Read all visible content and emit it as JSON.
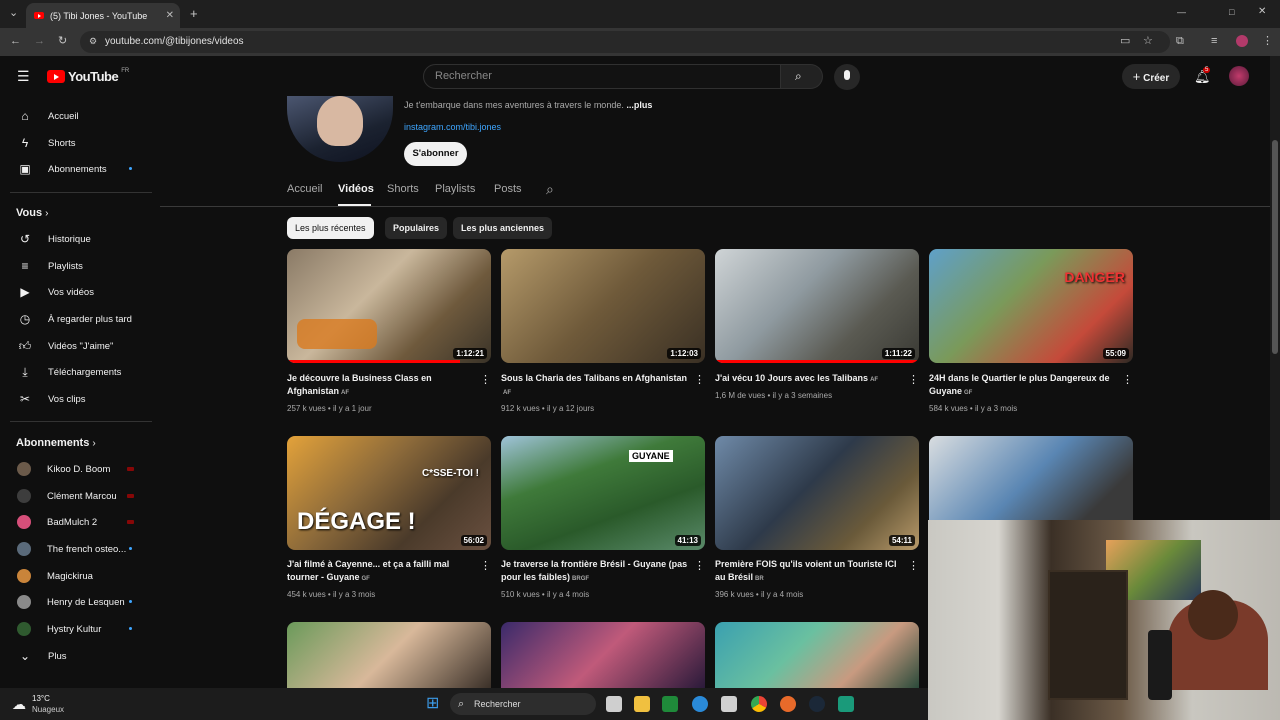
{
  "browser": {
    "tab_title": "(5) Tibi Jones - YouTube",
    "url": "youtube.com/@tibijones/videos"
  },
  "header": {
    "logo_text": "YouTube",
    "region": "FR",
    "search_placeholder": "Rechercher",
    "create_label": "Créer",
    "notif_count": "5"
  },
  "sidebar": {
    "main": [
      {
        "label": "Accueil",
        "icon": "home-icon"
      },
      {
        "label": "Shorts",
        "icon": "shorts-icon"
      },
      {
        "label": "Abonnements",
        "icon": "subscriptions-icon"
      }
    ],
    "you_title": "Vous",
    "you": [
      {
        "label": "Historique",
        "icon": "history-icon"
      },
      {
        "label": "Playlists",
        "icon": "playlists-icon"
      },
      {
        "label": "Vos vidéos",
        "icon": "your-videos-icon"
      },
      {
        "label": "À regarder plus tard",
        "icon": "watch-later-icon"
      },
      {
        "label": "Vidéos \"J'aime\"",
        "icon": "liked-icon"
      },
      {
        "label": "Téléchargements",
        "icon": "downloads-icon"
      },
      {
        "label": "Vos clips",
        "icon": "clips-icon"
      }
    ],
    "subs_title": "Abonnements",
    "subs": [
      {
        "label": "Kikoo D. Boom",
        "color": "#6b5a4a"
      },
      {
        "label": "Clément Marcou",
        "color": "#3d3d3d"
      },
      {
        "label": "BadMulch 2",
        "color": "#d64f7a"
      },
      {
        "label": "The french osteo...",
        "color": "#5a6a7a"
      },
      {
        "label": "Magickirua",
        "color": "#c9843a"
      },
      {
        "label": "Henry de Lesquen",
        "color": "#8a8a8a"
      },
      {
        "label": "Hystry Kultur",
        "color": "#2f5a2f"
      }
    ],
    "more_label": "Plus"
  },
  "channel": {
    "description": "Je t'embarque dans mes aventures à travers le monde.",
    "more": "...plus",
    "link": "instagram.com/tibi.jones",
    "subscribe_label": "S'abonner",
    "tabs": [
      "Accueil",
      "Vidéos",
      "Shorts",
      "Playlists",
      "Posts"
    ],
    "chips": [
      "Les plus récentes",
      "Populaires",
      "Les plus anciennes"
    ]
  },
  "videos": [
    {
      "title": "Je découvre la Business Class en Afghanistan",
      "flag": "AF",
      "views": "257 k vues",
      "age": "il y a 1 jour",
      "duration": "1:12:21",
      "progress": 0.85
    },
    {
      "title": "Sous la Charia des Talibans en Afghanistan",
      "flag": "AF",
      "views": "912 k vues",
      "age": "il y a 12 jours",
      "duration": "1:12:03",
      "progress": 0
    },
    {
      "title": "J'ai vécu 10 Jours avec les Talibans",
      "flag": "AF",
      "views": "1,6 M de vues",
      "age": "il y a 3 semaines",
      "duration": "1:11:22",
      "progress": 1.0
    },
    {
      "title": "24H dans le Quartier le plus Dangereux de Guyane",
      "flag": "GF",
      "views": "584 k vues",
      "age": "il y a 3 mois",
      "duration": "55:09",
      "progress": 0,
      "overlay": "DANGER"
    },
    {
      "title": "J'ai filmé à Cayenne... et ça a failli mal tourner - Guyane",
      "flag": "GF",
      "views": "454 k vues",
      "age": "il y a 3 mois",
      "duration": "56:02",
      "progress": 0,
      "overlay": "DÉGAGE !",
      "overlay2": "C*SSE-TOI !"
    },
    {
      "title": "Je traverse la frontière Brésil - Guyane (pas pour les faibles)",
      "flag": "BRGF",
      "views": "510 k vues",
      "age": "il y a 4 mois",
      "duration": "41:13",
      "progress": 0,
      "overlay": "GUYANE"
    },
    {
      "title": "Première FOIS qu'ils voient un Touriste ICI au Brésil",
      "flag": "BR",
      "views": "396 k vues",
      "age": "il y a 4 mois",
      "duration": "54:11",
      "progress": 0
    }
  ],
  "taskbar": {
    "temp": "13°C",
    "weather": "Nuageux",
    "search_label": "Rechercher"
  }
}
